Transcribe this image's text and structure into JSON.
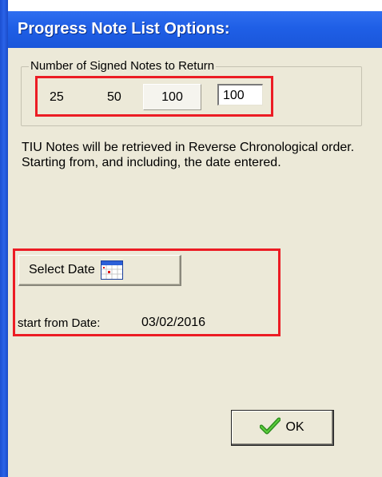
{
  "window": {
    "title": "Progress Note List Options:",
    "accent_color": "#1f5fe6"
  },
  "notes_group": {
    "legend": "Number of Signed Notes to Return",
    "options": [
      "25",
      "50",
      "100"
    ],
    "count_value": "100"
  },
  "info": {
    "text": "TIU Notes will be retrieved in Reverse Chronological order. Starting from, and including, the date entered."
  },
  "date": {
    "select_button_label": "Select Date",
    "select_button_icon": "calendar-icon",
    "start_label": "start from Date:",
    "start_value": "03/02/2016"
  },
  "footer": {
    "ok_label": "OK",
    "ok_icon": "checkmark-icon"
  },
  "highlight_color": "#ec1c24"
}
